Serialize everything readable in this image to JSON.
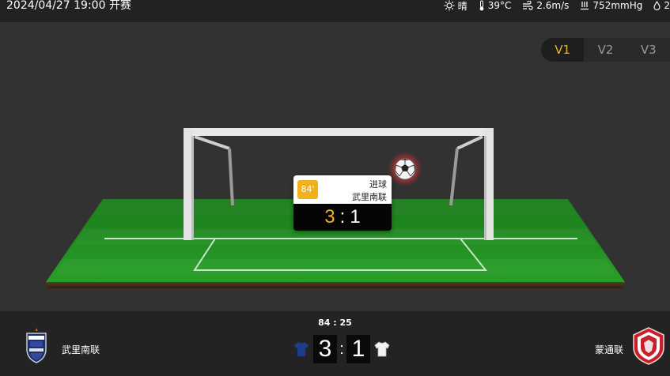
{
  "header": {
    "datetime": "2024/04/27 19:00 开赛",
    "weather": {
      "condition": "晴",
      "temperature": "39°C",
      "wind": "2.6m/s",
      "pressure": "752mmHg",
      "humidity_partial": "2"
    }
  },
  "view_tabs": [
    {
      "label": "V1",
      "active": true
    },
    {
      "label": "V2",
      "active": false
    },
    {
      "label": "V3",
      "active": false
    }
  ],
  "event": {
    "minute": "84'",
    "type": "进球",
    "team": "武里南联",
    "score_home": "3",
    "score_sep": ":",
    "score_away": "1"
  },
  "match": {
    "clock": "84 : 25",
    "home": {
      "name": "武里南联",
      "score": "3",
      "kit_color": "#1d3c8c"
    },
    "away": {
      "name": "蒙通联",
      "score": "1",
      "kit_color": "#f2f2f2"
    },
    "separator": ":"
  },
  "colors": {
    "accent": "#f0b21c",
    "pitch": "#1f8a1f",
    "background": "#333333"
  },
  "icons": {
    "sun": "sun-icon",
    "temp": "thermometer-icon",
    "wind": "wind-icon",
    "pressure": "pressure-icon",
    "humidity": "droplet-icon"
  }
}
